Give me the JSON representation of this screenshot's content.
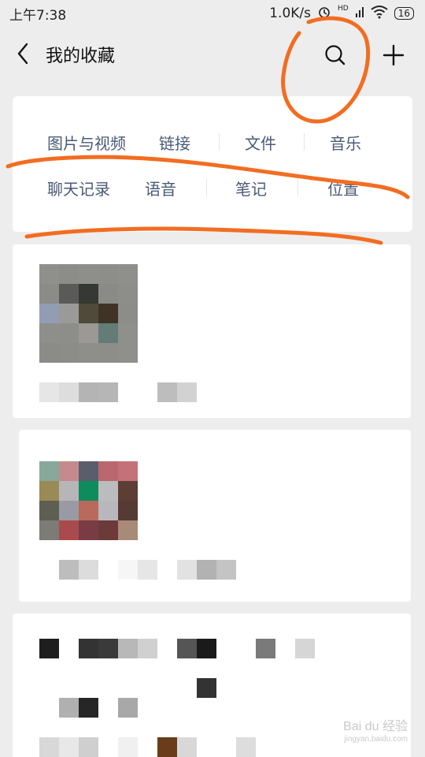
{
  "status_bar": {
    "time": "上午7:38",
    "speed": "1.0K/s",
    "hd": "HD",
    "battery": "16"
  },
  "nav": {
    "title": "我的收藏",
    "icons": [
      "chevron-left-icon",
      "search-icon",
      "plus-icon"
    ]
  },
  "categories": {
    "row1": [
      "图片与视频",
      "链接",
      "文件",
      "音乐"
    ],
    "row2": [
      "聊天记录",
      "语音",
      "笔记",
      "位置"
    ]
  },
  "favorites": {
    "item1_thumb": [
      "#8f8f8b",
      "#8c8c88",
      "#8e8e8a",
      "#8d8d89",
      "#8f8f8b",
      "#8b8b87",
      "#5a5a58",
      "#363833",
      "#8a8a86",
      "#8d8d89",
      "#929db4",
      "#9a9a98",
      "#4f4a3a",
      "#3f3325",
      "#8c8c88",
      "#8e8e8a",
      "#8d8d89",
      "#9b9895",
      "#637c77",
      "#8f8f8b",
      "#8b8b87",
      "#8c8c88",
      "#8e8e8a",
      "#8d8d89",
      "#8f8f8b"
    ],
    "item2_thumb": [
      "#87a89a",
      "#c58a8e",
      "#5a5e6c",
      "#b9686e",
      "#c47179",
      "#9a8a55",
      "#b6b6b8",
      "#0f8c5e",
      "#bcbcbe",
      "#5c3e34",
      "#5e5e52",
      "#9a9aa4",
      "#b86a5c",
      "#b8b8bc",
      "#583a34",
      "#7c7c76",
      "#a94b4c",
      "#7a3c44",
      "#6d3a3a",
      "#a88a78"
    ]
  },
  "watermark": {
    "text": "Bai du 经验",
    "sub": "jingyan.baidu.com"
  },
  "colors": {
    "annotation": "#f26d21",
    "category_text": "#4a5a78",
    "background": "#ededed"
  }
}
